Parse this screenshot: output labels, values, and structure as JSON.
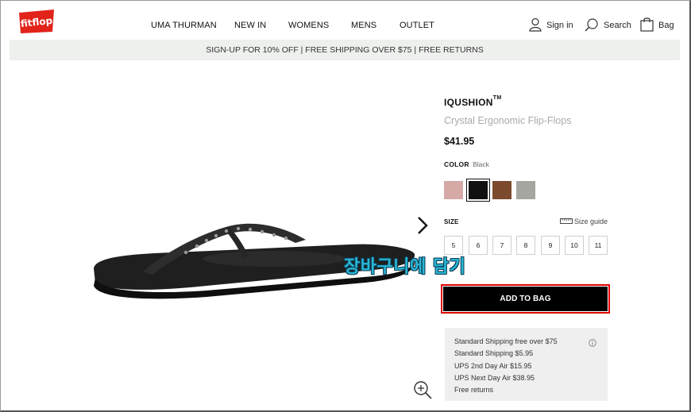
{
  "header": {
    "logo_text": "fitflop",
    "nav": [
      "UMA THURMAN",
      "NEW IN",
      "WOMENS",
      "MENS",
      "OUTLET"
    ],
    "sign_in": "Sign in",
    "search": "Search",
    "bag": "Bag"
  },
  "promo": "SIGN-UP FOR 10% OFF | FREE SHIPPING OVER $75 | FREE RETURNS",
  "overlay": "장바구니에 담기",
  "product": {
    "brand": "IQUSHION",
    "trademark": "TM",
    "name": "Crystal Ergonomic Flip-Flops",
    "price": "$41.95",
    "color_key": "COLOR",
    "color_value": "Black",
    "swatches": [
      {
        "name": "pink",
        "color": "#d4a9a6"
      },
      {
        "name": "black",
        "color": "#111111"
      },
      {
        "name": "brown",
        "color": "#7c4a2d"
      },
      {
        "name": "grey",
        "color": "#a6a6a0"
      }
    ],
    "size_label": "SIZE",
    "size_guide": "Size guide",
    "sizes": [
      "5",
      "6",
      "7",
      "8",
      "9",
      "10",
      "11"
    ],
    "add_to_bag": "ADD TO BAG"
  },
  "shipping": [
    "Standard Shipping free over $75",
    "Standard Shipping $5.95",
    "UPS 2nd Day Air $15.95",
    "UPS Next Day Air $38.95",
    "Free returns"
  ],
  "colors": {
    "accent_red": "#e00000",
    "logo_red": "#e2231a",
    "overlay": "#29b6d6"
  }
}
